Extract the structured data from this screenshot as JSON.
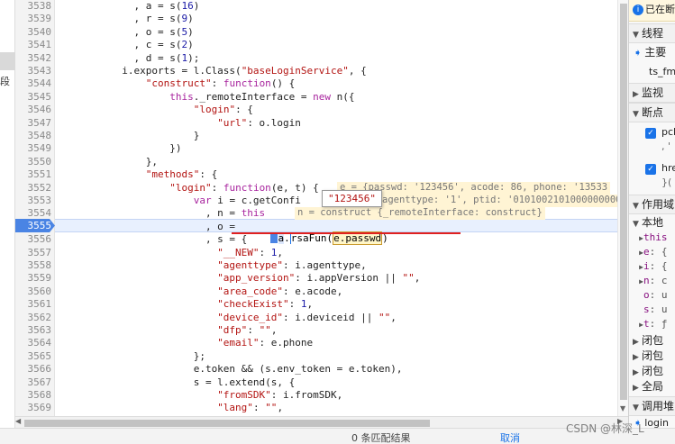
{
  "left_panel": {
    "segment_label": "段"
  },
  "editor": {
    "lines": [
      {
        "n": "3538",
        "html": "            , a = s(<span class=\"n\">16</span>)"
      },
      {
        "n": "3539",
        "html": "            , r = s(<span class=\"n\">9</span>)"
      },
      {
        "n": "3540",
        "html": "            , o = s(<span class=\"n\">5</span>)"
      },
      {
        "n": "3541",
        "html": "            , c = s(<span class=\"n\">2</span>)"
      },
      {
        "n": "3542",
        "html": "            , d = s(<span class=\"n\">1</span>);"
      },
      {
        "n": "3543",
        "html": "          i.exports = l.Class(<span class=\"s\">\"baseLoginService\"</span>, {"
      },
      {
        "n": "3544",
        "html": "              <span class=\"s\">\"construct\"</span>: <span class=\"k\">function</span>() {"
      },
      {
        "n": "3545",
        "html": "                  <span class=\"k\">this</span>._remoteInterface = <span class=\"k\">new</span> n({"
      },
      {
        "n": "3546",
        "html": "                      <span class=\"s\">\"login\"</span>: {"
      },
      {
        "n": "3547",
        "html": "                          <span class=\"s\">\"url\"</span>: o.login"
      },
      {
        "n": "3548",
        "html": "                      }"
      },
      {
        "n": "3549",
        "html": "                  })"
      },
      {
        "n": "3550",
        "html": "              },"
      },
      {
        "n": "3551",
        "html": "              <span class=\"s\">\"methods\"</span>: {"
      },
      {
        "n": "3552",
        "html": "                  <span class=\"s\">\"login\"</span>: <span class=\"k\">function</span>(e, t) {"
      },
      {
        "n": "3553",
        "html": "                      <span class=\"k\">var</span> i = c.getConfi"
      },
      {
        "n": "3554",
        "html": "                        , n = <span class=\"k\">this</span>"
      },
      {
        "n": "3555",
        "html": "                        , o = "
      },
      {
        "n": "3556",
        "html": "                        , s = {"
      },
      {
        "n": "3557",
        "html": "                          <span class=\"s\">\"__NEW\"</span>: <span class=\"n\">1</span>,"
      },
      {
        "n": "3558",
        "html": "                          <span class=\"s\">\"agenttype\"</span>: i.agenttype,"
      },
      {
        "n": "3559",
        "html": "                          <span class=\"s\">\"app_version\"</span>: i.appVersion || <span class=\"s\">\"\"</span>,"
      },
      {
        "n": "3560",
        "html": "                          <span class=\"s\">\"area_code\"</span>: e.acode,"
      },
      {
        "n": "3561",
        "html": "                          <span class=\"s\">\"checkExist\"</span>: <span class=\"n\">1</span>,"
      },
      {
        "n": "3562",
        "html": "                          <span class=\"s\">\"device_id\"</span>: i.deviceid || <span class=\"s\">\"\"</span>,"
      },
      {
        "n": "3563",
        "html": "                          <span class=\"s\">\"dfp\"</span>: <span class=\"s\">\"\"</span>,"
      },
      {
        "n": "3564",
        "html": "                          <span class=\"s\">\"email\"</span>: e.phone"
      },
      {
        "n": "3565",
        "html": "                      };"
      },
      {
        "n": "3566",
        "html": "                      e.token &amp;&amp; (s.env_token = e.token),"
      },
      {
        "n": "3567",
        "html": "                      s = l.extend(s, {"
      },
      {
        "n": "3568",
        "html": "                          <span class=\"s\">\"fromSDK\"</span>: i.fromSDK,"
      },
      {
        "n": "3569",
        "html": "                          <span class=\"s\">\"lang\"</span>: <span class=\"s\">\"\"</span>,"
      }
    ],
    "breakpoint_line": "3555",
    "inline_values": {
      "line_3552": "e = {passwd: '123456', acode: 86, phone: '13533",
      "line_3553": "agenttype: '1', ptid: '0101002101000000000",
      "line_3554": "n = construct {_remoteInterface: construct}"
    },
    "line_3555_call": {
      "obj": "a",
      "method": "rsaFun(",
      "arg_obj": "e",
      "arg_prop": ".passwd",
      "close": ")"
    },
    "tooltip_value": "\"123456\""
  },
  "right_panel": {
    "paused_label": "已在断",
    "threads_label": "线程",
    "main_thread": "主要",
    "ts_file": "ts_fm",
    "watch_label": "监视",
    "breakpoints_label": "断点",
    "bp1_text": "pcl",
    "bp1_sub": ", '",
    "bp2_text": "hre",
    "bp2_sub": "}(",
    "scope_label": "作用域",
    "local_label": "本地",
    "scope_items": [
      {
        "key": "this",
        "val": ""
      },
      {
        "key": "e",
        "val": ": {"
      },
      {
        "key": "i",
        "val": ": {"
      },
      {
        "key": "n",
        "val": ": c"
      },
      {
        "key": "o",
        "val": ": u"
      },
      {
        "key": "s",
        "val": ": u"
      },
      {
        "key": "t",
        "val": ": ƒ"
      }
    ],
    "closures": [
      "闭包",
      "闭包",
      "闭包"
    ],
    "global_label": "全局",
    "callstack_label": "调用堆",
    "callstack_top": "login"
  },
  "bottom_bar": {
    "text_a": "0 条匹配结果",
    "text_b": "取消"
  },
  "watermark": "CSDN @林深_L"
}
